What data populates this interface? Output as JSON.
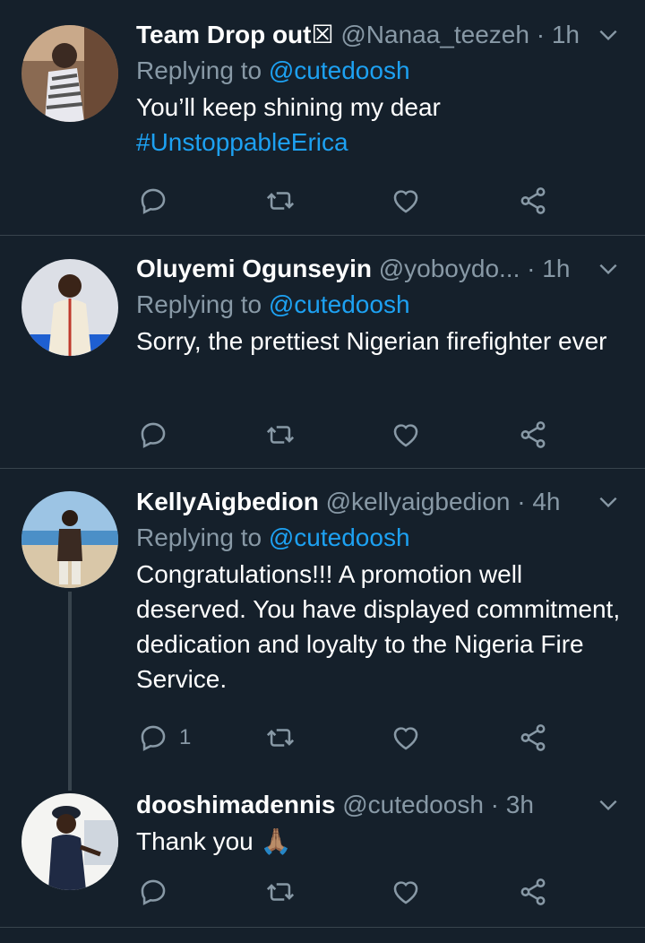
{
  "colors": {
    "background": "#15202b",
    "text": "#ffffff",
    "muted": "#8899a6",
    "accent": "#1da1f2",
    "divider": "#38444d"
  },
  "tweets": [
    {
      "name": "Team Drop out☒",
      "handle": "@Nanaa_teezeh",
      "sep": " · ",
      "time": "1h",
      "replying_prefix": "Replying to ",
      "replying_to": "@cutedoosh",
      "text": "You’ll keep shining my dear",
      "hashtag": "#UnstoppableErica",
      "reply_count": "",
      "avatar": "avatar-photo"
    },
    {
      "name": "Oluyemi Ogunseyin",
      "handle": "@yoboydo...",
      "sep": " · ",
      "time": "1h",
      "replying_prefix": "Replying to ",
      "replying_to": "@cutedoosh",
      "text": "Sorry, the prettiest Nigerian firefighter ever",
      "reply_count": "",
      "avatar": "avatar-photo"
    },
    {
      "name": "KellyAigbedion",
      "handle": "@kellyaigbedion",
      "sep": " · ",
      "time": "4h",
      "replying_prefix": "Replying to ",
      "replying_to": "@cutedoosh",
      "text": "Congratulations!!! A promotion well deserved. You have displayed commitment, dedication and loyalty to the Nigeria Fire Service.",
      "reply_count": "1",
      "avatar": "avatar-photo"
    },
    {
      "name": "dooshimadennis",
      "handle": "@cutedoosh",
      "sep": " · ",
      "time": "3h",
      "text": "Thank you 🙏🏽",
      "reply_count": "",
      "avatar": "avatar-photo"
    }
  ],
  "icons": [
    "reply-icon",
    "retweet-icon",
    "like-icon",
    "share-icon",
    "chevron-down-icon"
  ]
}
